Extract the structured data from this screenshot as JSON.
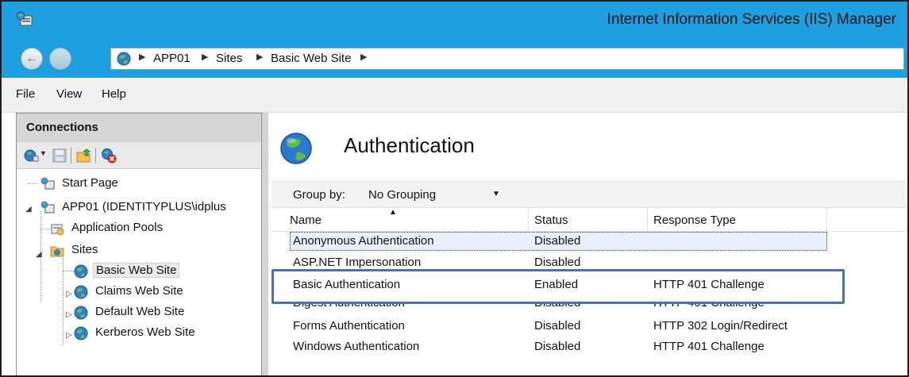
{
  "window": {
    "title": "Internet Information Services (IIS) Manager",
    "accent_color": "#1ea0e0"
  },
  "address": {
    "crumbs": [
      "APP01",
      "Sites",
      "Basic Web Site"
    ]
  },
  "menu": [
    "File",
    "View",
    "Help"
  ],
  "connections": {
    "header": "Connections",
    "toolbar_icons": [
      "connect-icon",
      "save-icon",
      "up-folder-icon",
      "disconnect-icon"
    ],
    "tree": {
      "start_page": "Start Page",
      "server": "APP01 (IDENTITYPLUS\\idplus",
      "app_pools": "Application Pools",
      "sites": "Sites",
      "site_list": [
        "Basic Web Site",
        "Claims Web Site",
        "Default Web Site",
        "Kerberos Web Site"
      ],
      "selected": "Basic Web Site"
    }
  },
  "main": {
    "title": "Authentication",
    "group_by_label": "Group by:",
    "group_by_value": "No Grouping",
    "columns": [
      "Name",
      "Status",
      "Response Type"
    ],
    "rows": [
      {
        "name": "Anonymous Authentication",
        "status": "Disabled",
        "response": ""
      },
      {
        "name": "ASP.NET Impersonation",
        "status": "Disabled",
        "response": ""
      },
      {
        "name": "Basic Authentication",
        "status": "Enabled",
        "response": "HTTP 401 Challenge"
      },
      {
        "name": "Digest Authentication",
        "status": "Disabled",
        "response": "HTTP 401 Challenge"
      },
      {
        "name": "Forms Authentication",
        "status": "Disabled",
        "response": "HTTP 302 Login/Redirect"
      },
      {
        "name": "Windows Authentication",
        "status": "Disabled",
        "response": "HTTP 401 Challenge"
      }
    ],
    "highlight_color": "#4a72b3"
  }
}
